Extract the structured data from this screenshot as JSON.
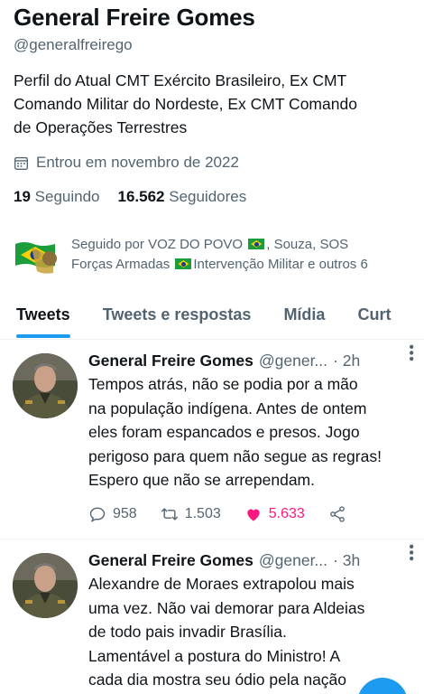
{
  "profile": {
    "name": "General Freire Gomes",
    "handle": "@generalfreirego",
    "bio_lines": [
      "Perfil do Atual CMT Exército Brasileiro, Ex CMT",
      "Comando Militar do Nordeste, Ex CMT Comando",
      "de Operações Terrestres"
    ],
    "joined": "Entrou em novembro de 2022",
    "following_count": "19",
    "following_label": "Seguindo",
    "followers_count": "16.562",
    "followers_label": "Seguidores",
    "followed_by_line1_a": "Seguido por VOZ DO POVO",
    "followed_by_line1_b": ", Souza, SOS",
    "followed_by_line2_a": "Forças Armadas",
    "followed_by_line2_b": "Intervenção Militar e outros 6"
  },
  "tabs": [
    "Tweets",
    "Tweets e respostas",
    "Mídia",
    "Curt"
  ],
  "tweets": [
    {
      "name": "General Freire Gomes",
      "handle": "@gener...",
      "time": "· 2h",
      "lines": [
        "Tempos atrás, não se podia por a mão",
        "na população indígena. Antes de ontem",
        "eles  foram espancados e presos. Jogo",
        "perigoso para quem não segue as regras!",
        "Espero que não se arrependam."
      ],
      "replies": "958",
      "retweets": "1.503",
      "likes": "5.633"
    },
    {
      "name": "General Freire Gomes",
      "handle": "@gener...",
      "time": "· 3h",
      "lines": [
        "Alexandre de Moraes extrapolou mais",
        "uma vez. Não vai demorar para Aldeias",
        "de todo pais invadir Brasília.",
        "Lamentável a postura do Ministro! A",
        "cada dia mostra seu ódio pela nação"
      ]
    }
  ],
  "colors": {
    "accent": "#1d9bf0",
    "like": "#f91880",
    "muted": "#536471"
  }
}
